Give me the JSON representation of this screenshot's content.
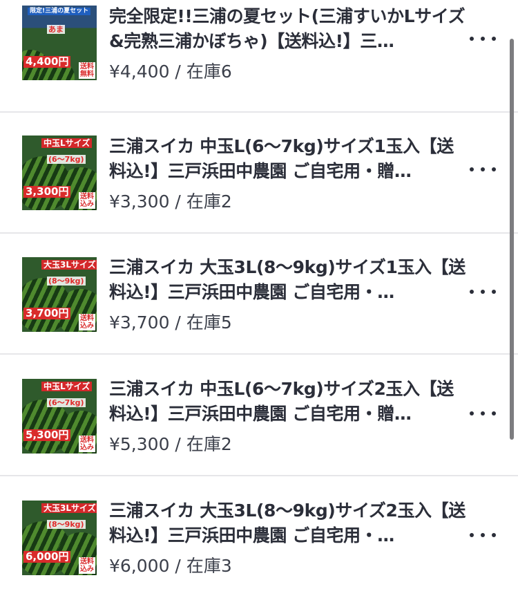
{
  "products": [
    {
      "title": "完全限定!!三浦の夏セット(三浦すいかLサイズ&完熟三浦かぼちゃ)【送料込!】三…",
      "price": "¥4,400",
      "stock": "在庫6",
      "thumb_tag1": "限定!三浦の夏セット",
      "thumb_tag2": "あま",
      "thumb_price": "4,400円",
      "thumb_shipping": "送料\n無料"
    },
    {
      "title": "三浦スイカ 中玉L(6〜7kg)サイズ1玉入【送料込!】三戸浜田中農園 ご自宅用・贈…",
      "price": "¥3,300",
      "stock": "在庫2",
      "thumb_tag1": "中玉Lサイズ",
      "thumb_tag2": "(6〜7kg)",
      "thumb_price": "3,300円",
      "thumb_shipping": "送料\n込み"
    },
    {
      "title": "三浦スイカ 大玉3L(8〜9kg)サイズ1玉入【送料込!】三戸浜田中農園 ご自宅用・…",
      "price": "¥3,700",
      "stock": "在庫5",
      "thumb_tag1": "大玉3Lサイズ",
      "thumb_tag2": "(8〜9kg)",
      "thumb_price": "3,700円",
      "thumb_shipping": "送料\n込み"
    },
    {
      "title": "三浦スイカ 中玉L(6〜7kg)サイズ2玉入【送料込!】三戸浜田中農園 ご自宅用・贈…",
      "price": "¥5,300",
      "stock": "在庫2",
      "thumb_tag1": "中玉Lサイズ",
      "thumb_tag2": "(6〜7kg)",
      "thumb_price": "5,300円",
      "thumb_shipping": "送料\n込み"
    },
    {
      "title": "三浦スイカ 大玉3L(8〜9kg)サイズ2玉入【送料込!】三戸浜田中農園 ご自宅用・…",
      "price": "¥6,000",
      "stock": "在庫3",
      "thumb_tag1": "大玉3Lサイズ",
      "thumb_tag2": "(8〜9kg)",
      "thumb_price": "6,000円",
      "thumb_shipping": "送料\n込み"
    }
  ],
  "price_separator": " / ",
  "more_icon": "more-horizontal-icon",
  "colors": {
    "title": "#2b2e39",
    "price": "#3b3f4a",
    "divider": "#e6e6e9",
    "scrollbar": "#7d7d80"
  }
}
